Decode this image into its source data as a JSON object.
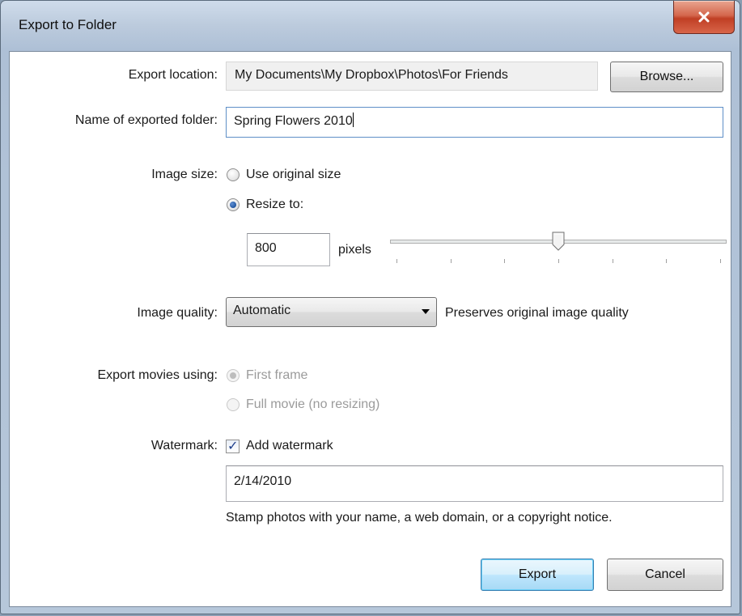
{
  "window": {
    "title": "Export to Folder"
  },
  "export_location": {
    "label": "Export location:",
    "value": "My Documents\\My Dropbox\\Photos\\For Friends",
    "browse_label": "Browse..."
  },
  "folder_name": {
    "label": "Name of exported folder:",
    "value": "Spring Flowers 2010"
  },
  "image_size": {
    "label": "Image size:",
    "option_original": "Use original size",
    "option_resize": "Resize to:",
    "selected": "resize",
    "pixels_value": "800",
    "pixels_unit": "pixels",
    "slider_fraction": 0.5
  },
  "image_quality": {
    "label": "Image quality:",
    "selected": "Automatic",
    "description": "Preserves original image quality"
  },
  "export_movies": {
    "label": "Export movies using:",
    "option_first_frame": "First frame",
    "option_full_movie": "Full movie (no resizing)",
    "selected": "first_frame",
    "enabled": false
  },
  "watermark": {
    "label": "Watermark:",
    "checkbox_label": "Add watermark",
    "checked": true,
    "text_value": "2/14/2010",
    "help": "Stamp photos with your name, a web domain, or a copyright notice."
  },
  "buttons": {
    "export": "Export",
    "cancel": "Cancel"
  }
}
